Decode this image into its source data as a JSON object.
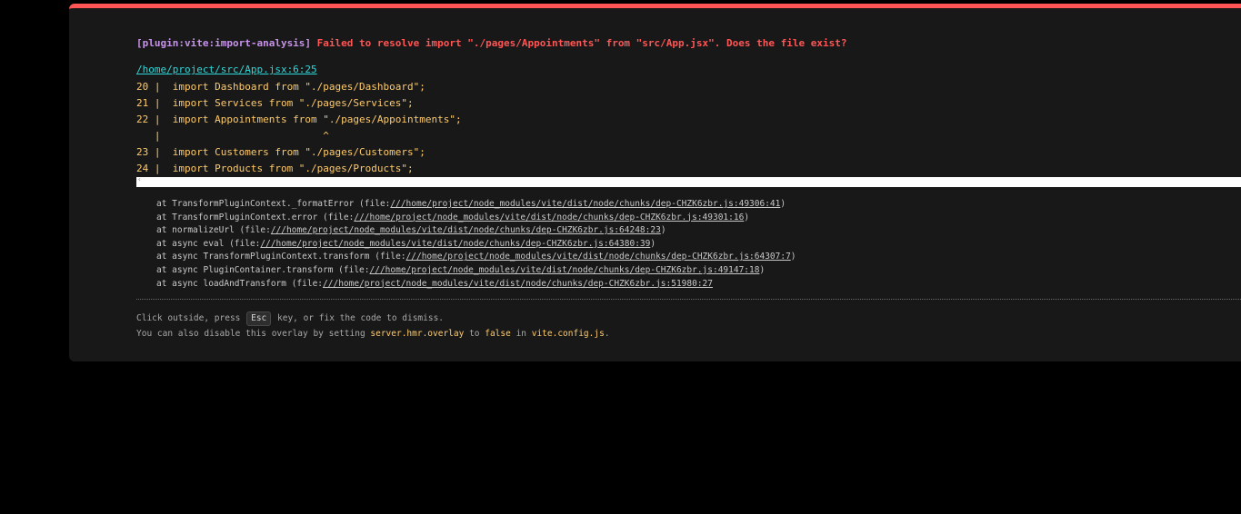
{
  "error": {
    "plugin": "[plugin:vite:import-analysis]",
    "message": " Failed to resolve import \"./pages/Appointments\" from \"src/App.jsx\". Does the file exist?",
    "file": "/home/project/src/App.jsx:6:25"
  },
  "frame": [
    "20 |  import Dashboard from \"./pages/Dashboard\";",
    "21 |  import Services from \"./pages/Services\";",
    "22 |  import Appointments from \"./pages/Appointments\";",
    "   |                           ^",
    "23 |  import Customers from \"./pages/Customers\";",
    "24 |  import Products from \"./pages/Products\";"
  ],
  "scroll_arrow": "‹",
  "stack": [
    {
      "prefix": "at TransformPluginContext._formatError (file:",
      "path": "///home/project/node_modules/vite/dist/node/chunks/dep-CHZK6zbr.js:49306:41",
      "suffix": ")"
    },
    {
      "prefix": "at TransformPluginContext.error (file:",
      "path": "///home/project/node_modules/vite/dist/node/chunks/dep-CHZK6zbr.js:49301:16",
      "suffix": ")"
    },
    {
      "prefix": "at normalizeUrl (file:",
      "path": "///home/project/node_modules/vite/dist/node/chunks/dep-CHZK6zbr.js:64248:23",
      "suffix": ")"
    },
    {
      "prefix": "at async eval (file:",
      "path": "///home/project/node_modules/vite/dist/node/chunks/dep-CHZK6zbr.js:64380:39",
      "suffix": ")"
    },
    {
      "prefix": "at async TransformPluginContext.transform (file:",
      "path": "///home/project/node_modules/vite/dist/node/chunks/dep-CHZK6zbr.js:64307:7",
      "suffix": ")"
    },
    {
      "prefix": "at async PluginContainer.transform (file:",
      "path": "///home/project/node_modules/vite/dist/node/chunks/dep-CHZK6zbr.js:49147:18",
      "suffix": ")"
    },
    {
      "prefix": "at async loadAndTransform (file:",
      "path": "///home/project/node_modules/vite/dist/node/chunks/dep-CHZK6zbr.js:51980:27",
      "suffix": ""
    }
  ],
  "tip": {
    "line1_before": "Click outside, press ",
    "line1_key": "Esc",
    "line1_after": " key, or fix the code to dismiss.",
    "line2_a": "You can also disable this overlay by setting ",
    "line2_code1": "server.hmr.overlay",
    "line2_b": " to ",
    "line2_code2": "false",
    "line2_c": " in ",
    "line2_code3": "vite.config.js",
    "line2_d": "."
  },
  "colors": {
    "accent_red": "#ff5555",
    "plugin_purple": "#c792ea",
    "link_cyan": "#2dd9da",
    "code_yellow": "#ffcb6b"
  }
}
